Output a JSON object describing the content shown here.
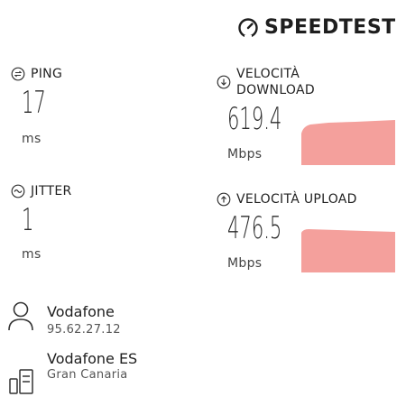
{
  "brand": {
    "name": "SPEEDTEST",
    "icon": "gauge-icon"
  },
  "ping": {
    "label": "PING",
    "value": "17",
    "unit": "ms",
    "icon": "ping-icon"
  },
  "jitter": {
    "label": "JITTER",
    "value": "1",
    "unit": "ms",
    "icon": "jitter-icon"
  },
  "download": {
    "label_line1": "VELOCITÀ",
    "label_line2": "DOWNLOAD",
    "value": "619.4",
    "unit": "Mbps",
    "icon": "download-icon"
  },
  "upload": {
    "label": "VELOCITÀ UPLOAD",
    "value": "476.5",
    "unit": "Mbps",
    "icon": "upload-icon"
  },
  "provider": {
    "name": "Vodafone",
    "ip": "95.62.27.12",
    "icon": "user-icon"
  },
  "server": {
    "name": "Vodafone ES",
    "location": "Gran Canaria",
    "icon": "server-icon"
  },
  "colors": {
    "graph_fill": "#f4a09c",
    "text": "#222222"
  }
}
